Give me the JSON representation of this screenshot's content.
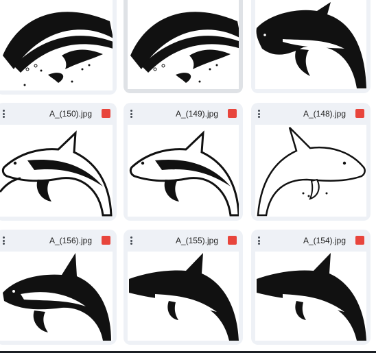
{
  "icons": {
    "menu": "more-vert-icon",
    "file_type": "image-file-icon"
  },
  "accent": {
    "image_icon": "#e8453c"
  },
  "files": [
    {
      "name": "",
      "variant": "bw-splash"
    },
    {
      "name": "",
      "variant": "bw-splash"
    },
    {
      "name": "",
      "variant": "solid-right"
    },
    {
      "name": "A_(150).jpg",
      "variant": "outline-left"
    },
    {
      "name": "A_(149).jpg",
      "variant": "outline-left"
    },
    {
      "name": "A_(148).jpg",
      "variant": "outline-right"
    },
    {
      "name": "A_(156).jpg",
      "variant": "solid-left"
    },
    {
      "name": "A_(155).jpg",
      "variant": "solid-jump"
    },
    {
      "name": "A_(154).jpg",
      "variant": "solid-jump"
    }
  ]
}
